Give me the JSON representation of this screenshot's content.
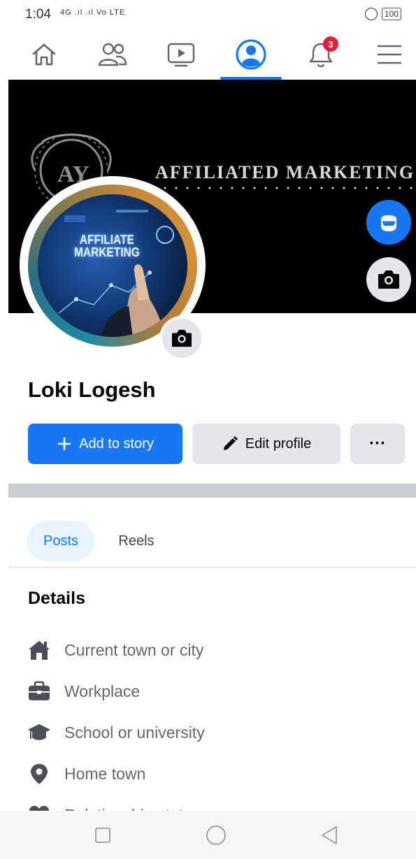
{
  "status_bar": {
    "time": "1:04",
    "signal": "4G .ıl .ıl Vo LTE",
    "battery": "100"
  },
  "nav": {
    "notifications_badge": "3",
    "items": [
      "home-icon",
      "friends-icon",
      "video-icon",
      "profile-icon",
      "notifications-icon",
      "menu-icon"
    ],
    "active": "profile-icon"
  },
  "cover": {
    "text": "AFFILIATED MARKETING",
    "ornament_initials": "AY"
  },
  "profile_picture": {
    "text_line1": "AFFILIATE",
    "text_line2": "MARKETING"
  },
  "profile": {
    "name": "Loki Logesh"
  },
  "actions": {
    "add_story": "Add to story",
    "edit_profile": "Edit profile",
    "more": "···"
  },
  "tabs": [
    {
      "label": "Posts",
      "active": true
    },
    {
      "label": "Reels",
      "active": false
    }
  ],
  "details": {
    "title": "Details",
    "items": [
      {
        "icon": "house-icon",
        "label": "Current town or city"
      },
      {
        "icon": "briefcase-icon",
        "label": "Workplace"
      },
      {
        "icon": "graduation-cap-icon",
        "label": "School or university"
      },
      {
        "icon": "location-pin-icon",
        "label": "Home town"
      },
      {
        "icon": "heart-icon",
        "label": "Relationship status"
      }
    ]
  },
  "colors": {
    "accent": "#1877f2",
    "badge": "#e41e3f",
    "icon_gray": "#606770"
  }
}
